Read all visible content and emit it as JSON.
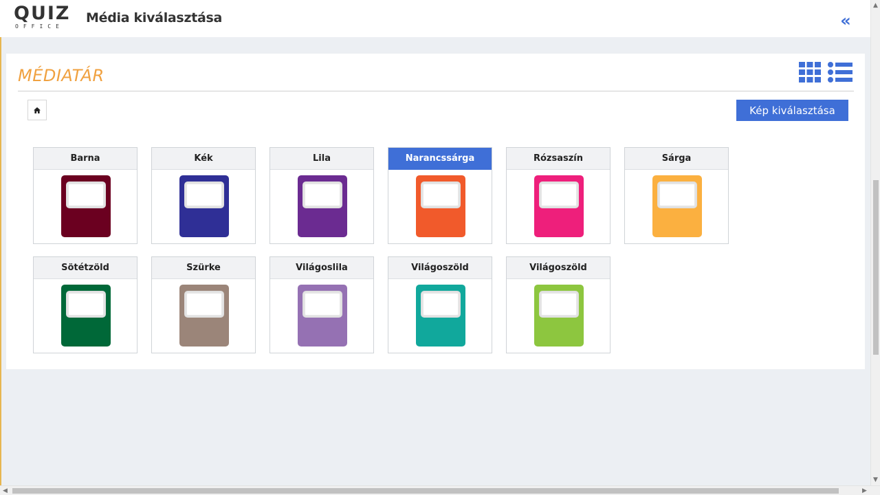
{
  "header": {
    "logo_main": "QUIZ",
    "logo_sub": "OFFICE",
    "title": "Média kiválasztása",
    "collapse_icon": "«"
  },
  "panel": {
    "title": "MÉDIATÁR",
    "select_button": "Kép kiválasztása"
  },
  "folders": [
    {
      "label": "Barna",
      "color": "#6b0020",
      "active": false
    },
    {
      "label": "Kék",
      "color": "#2f2f96",
      "active": false
    },
    {
      "label": "Lila",
      "color": "#6b2b91",
      "active": false
    },
    {
      "label": "Narancssárga",
      "color": "#f15a2b",
      "active": true
    },
    {
      "label": "Rózsaszín",
      "color": "#ee1f7b",
      "active": false
    },
    {
      "label": "Sárga",
      "color": "#fbb040",
      "active": false
    },
    {
      "label": "Sötétzöld",
      "color": "#006838",
      "active": false
    },
    {
      "label": "Szürke",
      "color": "#9b8579",
      "active": false
    },
    {
      "label": "Világoslila",
      "color": "#9571b3",
      "active": false
    },
    {
      "label": "Világoszöld",
      "color": "#11a89c",
      "active": false
    },
    {
      "label": "Világoszöld",
      "color": "#8dc63f",
      "active": false
    }
  ],
  "colors": {
    "accent": "#3f6fd7",
    "title_orange": "#f0a140",
    "background": "#eceff3"
  },
  "icons": {
    "home": "home-icon",
    "grid_view": "grid-view-icon",
    "list_view": "list-view-icon",
    "collapse": "double-chevron-left-icon"
  }
}
